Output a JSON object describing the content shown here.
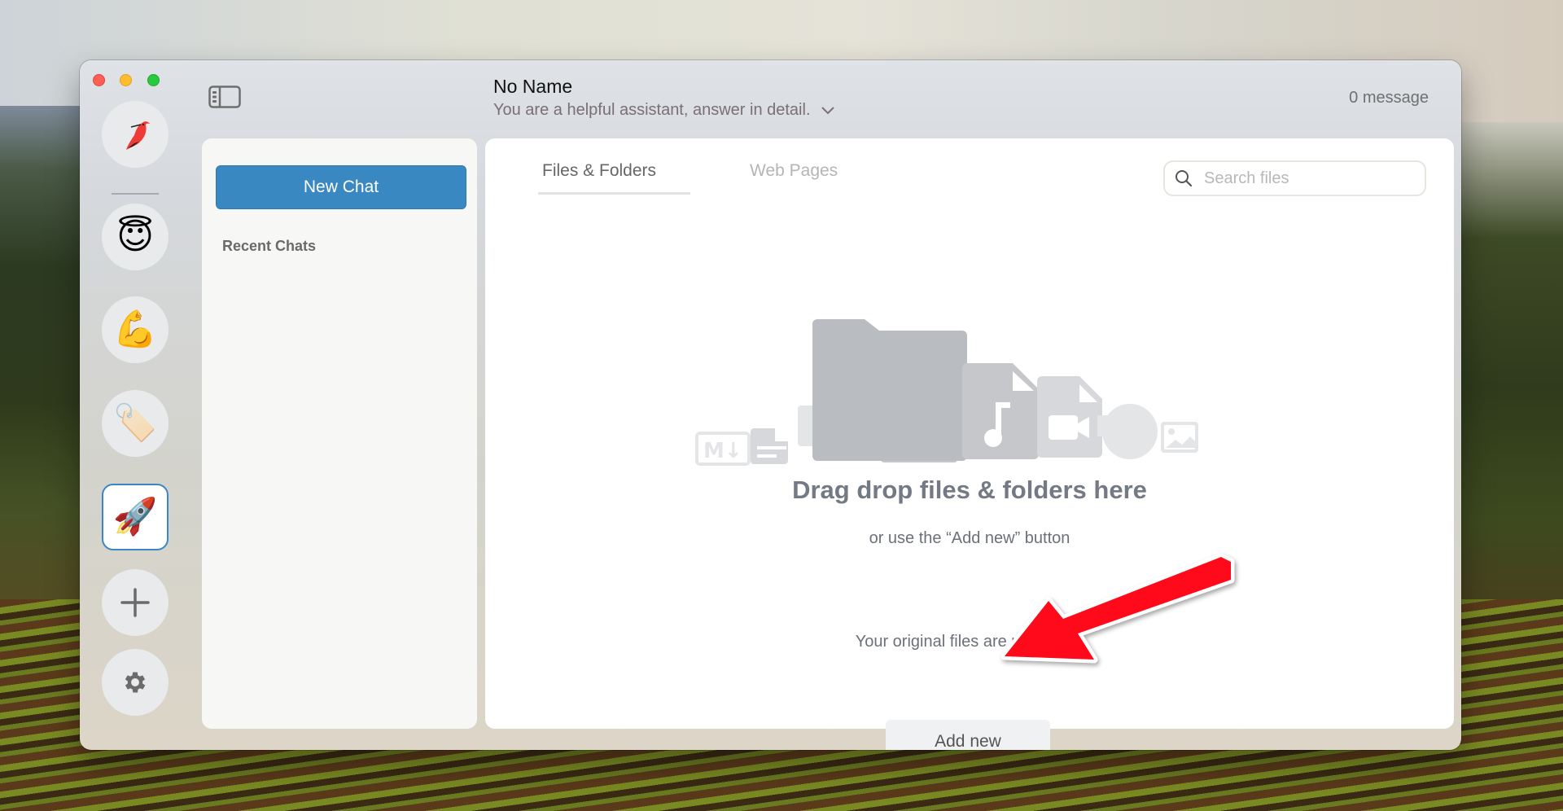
{
  "window": {
    "title": "No Name",
    "subtitle": "You are a helpful assistant, answer in detail.",
    "message_count": "0 message"
  },
  "rail": {
    "items": [
      {
        "name": "app-logo",
        "icon": "red-bird-logo",
        "selected": false
      },
      {
        "name": "assistant-angel",
        "icon": "😇",
        "selected": false
      },
      {
        "name": "assistant-muscle",
        "icon": "💪",
        "selected": false
      },
      {
        "name": "assistant-tag",
        "icon": "🏷️",
        "selected": false
      },
      {
        "name": "assistant-rocket",
        "icon": "🚀",
        "selected": true
      }
    ],
    "add_icon": "plus-icon",
    "settings_icon": "gear-icon"
  },
  "sidebar": {
    "new_chat_label": "New Chat",
    "recent_chats_label": "Recent Chats"
  },
  "main": {
    "tabs": [
      {
        "label": "Files & Folders",
        "active": true
      },
      {
        "label": "Web Pages",
        "active": false
      }
    ],
    "search": {
      "placeholder": "Search files",
      "value": ""
    },
    "drop_heading": "Drag drop files & folders here",
    "drop_sub": "or use the “Add new” button",
    "drop_note": "Your original files are not stored",
    "add_new_label": "Add new",
    "file_type_icons": [
      "markdown",
      "text-document",
      "generic-file",
      "pdf",
      "folder",
      "audio",
      "video",
      "camera",
      "image"
    ]
  },
  "annotation": {
    "type": "arrow",
    "color": "#ff0a1a",
    "points_to": "add-new-button"
  }
}
